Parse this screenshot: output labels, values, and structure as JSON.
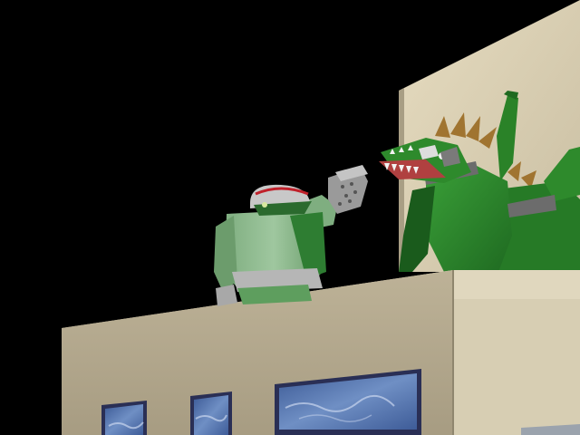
{
  "scene": {
    "colors": {
      "sky": "#000000",
      "building_front": "#b8ad92",
      "building_front_shade": "#9e947b",
      "building_top": "#d8ceb2",
      "building_top_light": "#ece4cc",
      "window_frame": "#2a2f55",
      "window_glass": "#4f6fa8",
      "window_cloud": "#c9d6ee",
      "mech_green_light": "#8fbf8f",
      "mech_green": "#5e9e5e",
      "mech_green_dark": "#2f6a33",
      "mech_grey": "#b6b6b6",
      "mech_grey_dark": "#6c6c6c",
      "helmet_stripe": "#c0202a",
      "dragon_green": "#2e8a2c",
      "dragon_green_dark": "#1a5b1c",
      "dragon_spike": "#a07430",
      "dragon_teeth": "#f2f2f2",
      "dragon_mouth": "#b04040"
    },
    "objects": [
      "night-sky",
      "left-building",
      "right-tower",
      "building-windows",
      "green-mech-fighter",
      "green-dragon-kaiju"
    ]
  }
}
